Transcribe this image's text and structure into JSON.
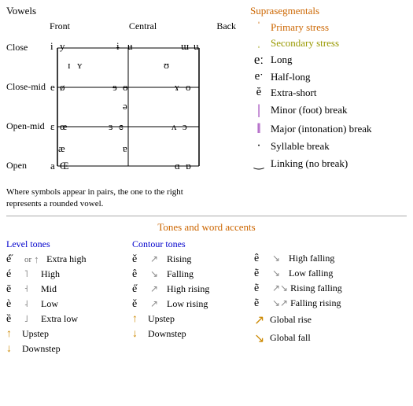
{
  "vowels": {
    "title": "Vowels",
    "col_headers": [
      "Front",
      "Central",
      "Back"
    ],
    "row_labels": [
      "Close",
      "Close-mid",
      "Open-mid",
      "Open"
    ],
    "note": "Where symbols appear in pairs, the one to the right\nrepresents a rounded vowel."
  },
  "suprasegmentals": {
    "title": "Suprasegmentals",
    "items": [
      {
        "symbol": "ˈ",
        "label": "Primary stress",
        "color": "primary"
      },
      {
        "symbol": "ˌ",
        "label": "Secondary stress",
        "color": "secondary"
      },
      {
        "symbol": "eː",
        "label": "Long",
        "color": "normal"
      },
      {
        "symbol": "eˑ",
        "label": "Half-long",
        "color": "normal"
      },
      {
        "symbol": "ĕ",
        "label": "Extra-short",
        "color": "normal"
      },
      {
        "symbol": "|",
        "label": "Minor (foot) break",
        "color": "normal"
      },
      {
        "symbol": "‖",
        "label": "Major (intonation) break",
        "color": "normal"
      },
      {
        "symbol": ".",
        "label": "Syllable break",
        "color": "normal"
      },
      {
        "symbol": "‿",
        "label": "Linking (no break)",
        "color": "normal"
      }
    ]
  },
  "tones": {
    "title": "Tones and word accents",
    "level_title": "Level tones",
    "contour_title": "Contour tones",
    "level_rows": [
      {
        "example": "é̋",
        "arrow": "↑",
        "label": "Extra high"
      },
      {
        "example": "é",
        "arrow": "↑",
        "label": "High"
      },
      {
        "example": "ē",
        "arrow": "—",
        "label": "Mid"
      },
      {
        "example": "è",
        "arrow": "↓",
        "label": "Low"
      },
      {
        "example": "ȅ",
        "arrow": "↓",
        "label": "Extra low"
      },
      {
        "example": "↗",
        "arrow": "",
        "label": "Upstep"
      },
      {
        "example": "↘",
        "arrow": "",
        "label": "Downstep"
      }
    ],
    "contour_rows": [
      {
        "example": "ě",
        "arrow": "↗",
        "label": "Rising"
      },
      {
        "example": "ê",
        "arrow": "↘",
        "label": "Falling"
      },
      {
        "example": "ě",
        "arrow": "↗↘",
        "label": "High rising"
      },
      {
        "example": "ě",
        "arrow": "↗",
        "label": "Low rising"
      },
      {
        "example": "↑",
        "arrow": "",
        "label": "Upstep"
      },
      {
        "example": "↓",
        "arrow": "",
        "label": "Downstep"
      }
    ],
    "high_falling_label": "High falling",
    "low_falling_label": "Low falling",
    "rising_falling_label": "Rising falling",
    "falling_rising_label": "Falling rising",
    "global_rise_label": "Global rise",
    "global_fall_label": "Global fall"
  }
}
